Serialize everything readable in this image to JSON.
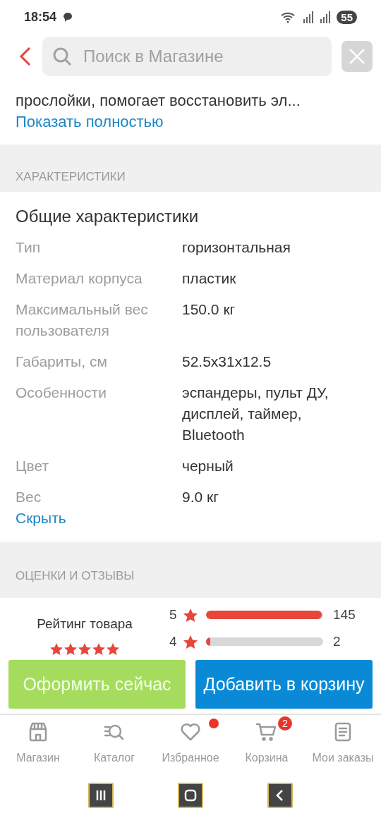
{
  "status_bar": {
    "time": "18:54",
    "battery": "55"
  },
  "header": {
    "search": {
      "placeholder": "Поиск в Магазине"
    }
  },
  "description": {
    "text": "прослойки, помогает восстановить эл...",
    "link": "Показать полностью"
  },
  "specs": {
    "section_title": "ХАРАКТЕРИСТИКИ",
    "group_title": "Общие характеристики",
    "rows": [
      {
        "label": "Тип",
        "value": "горизонтальная"
      },
      {
        "label": "Материал корпуса",
        "value": "пластик"
      },
      {
        "label": "Максимальный вес пользователя",
        "value": "150.0 кг"
      },
      {
        "label": "Габариты, см",
        "value": "52.5x31x12.5"
      },
      {
        "label": "Особенности",
        "value": "эспандеры, пульт ДУ, дисплей, таймер, Bluetooth"
      },
      {
        "label": "Цвет",
        "value": "черный"
      },
      {
        "label": "Вес",
        "value": "9.0 кг"
      }
    ],
    "link": "Скрыть"
  },
  "reviews": {
    "section_title": "ОЦЕНКИ И ОТЗЫВЫ",
    "rating_label": "Рейтинг товара",
    "stars": 5,
    "bars": [
      {
        "score": "5",
        "level": 0.99,
        "count": "145"
      },
      {
        "score": "4",
        "level": 0.02,
        "count": "2"
      }
    ]
  },
  "actions": [
    {
      "label": "Оформить сейчас",
      "kind": "secondary"
    },
    {
      "label": "Добавить в корзину",
      "kind": "primary"
    }
  ],
  "tabbar": [
    {
      "label": "Магазин",
      "kind": "store",
      "dot": false
    },
    {
      "label": "Каталог",
      "kind": "catalog",
      "dot": false
    },
    {
      "label": "Избранное",
      "kind": "favorites",
      "dot": true
    },
    {
      "label": "Корзина",
      "kind": "cart",
      "dot": false,
      "badge": "2"
    },
    {
      "label": "Мои заказы",
      "kind": "orders",
      "dot": false
    }
  ]
}
